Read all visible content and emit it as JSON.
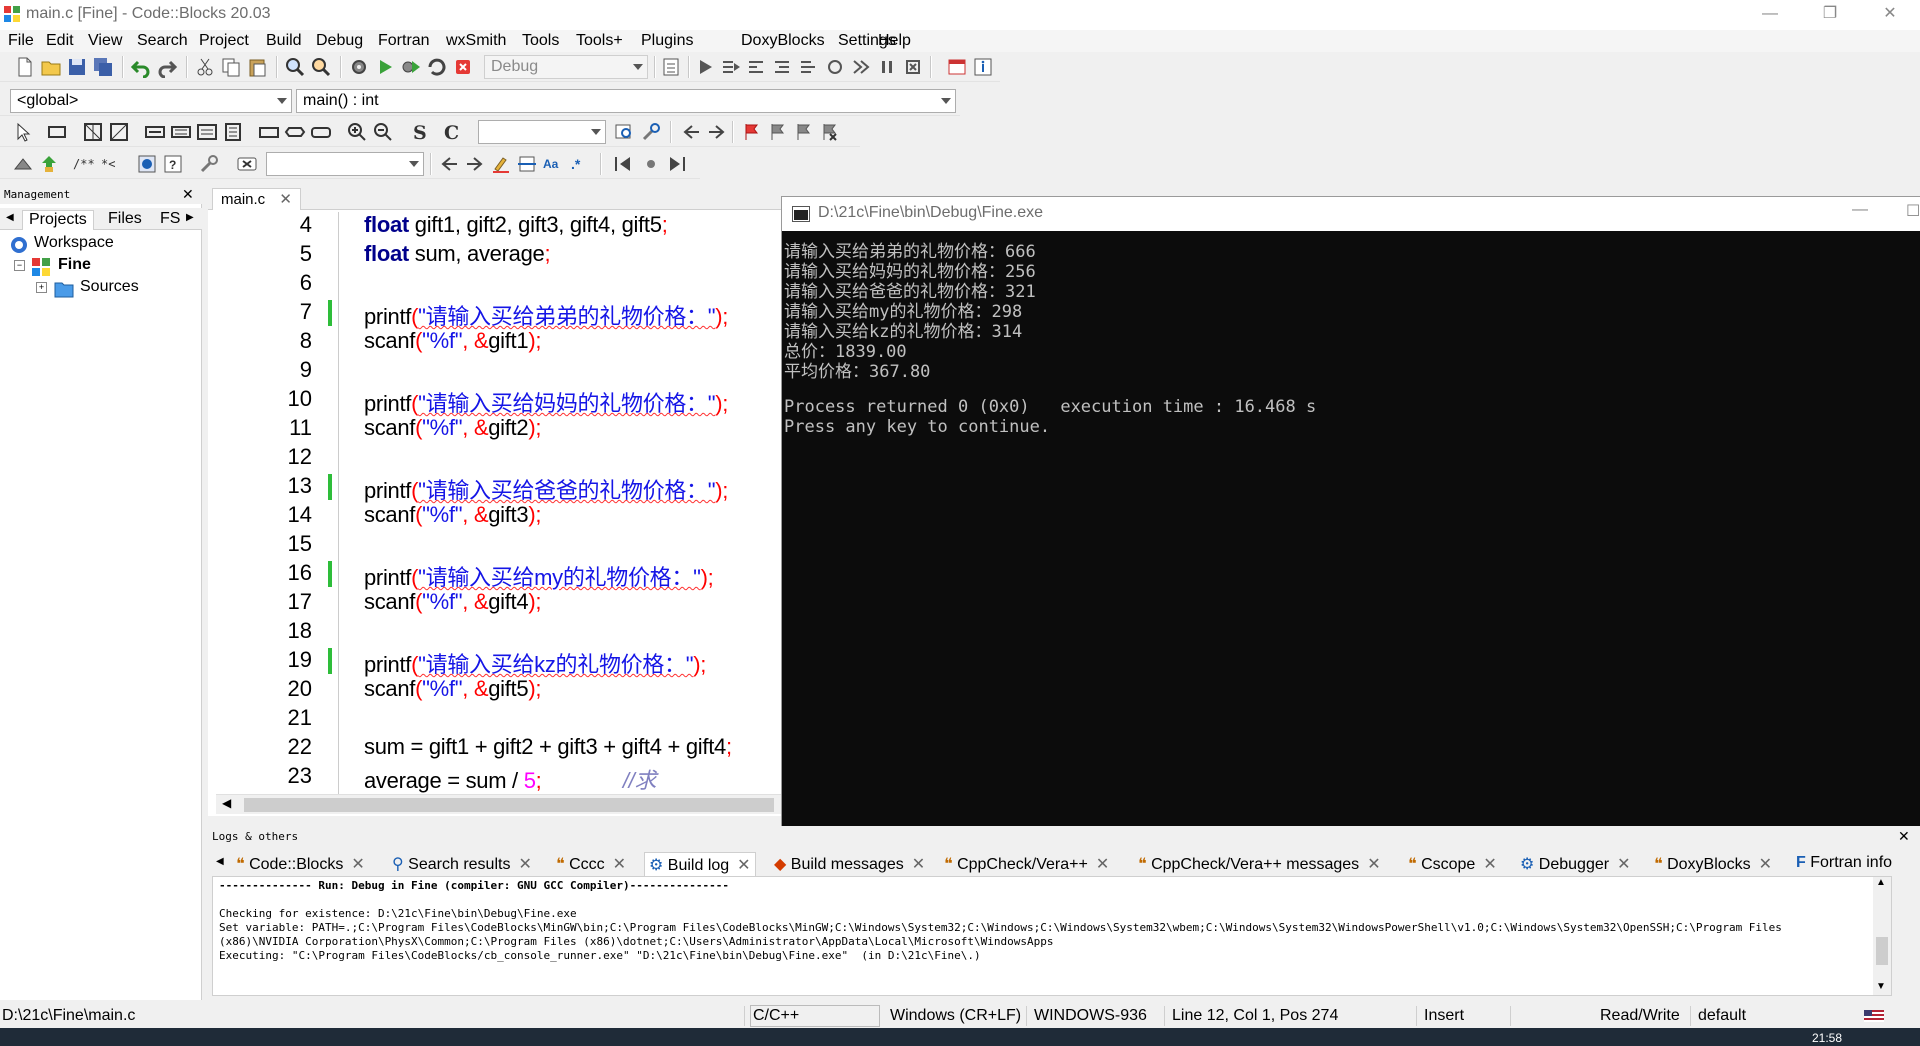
{
  "window": {
    "title": "main.c [Fine] - Code::Blocks 20.03"
  },
  "menu": [
    "File",
    "Edit",
    "View",
    "Search",
    "Project",
    "Build",
    "Debug",
    "Fortran",
    "wxSmith",
    "Tools",
    "Tools+",
    "Plugins",
    "DoxyBlocks",
    "Settings",
    "Help"
  ],
  "toolbar": {
    "build_target": "Debug",
    "scope": "<global>",
    "function": "main() : int"
  },
  "management": {
    "header": "Management",
    "tabs": [
      "Projects",
      "Files",
      "FS"
    ],
    "tree": {
      "workspace": "Workspace",
      "project": "Fine",
      "folder": "Sources"
    }
  },
  "editor": {
    "tab": "main.c",
    "lines": [
      {
        "n": "4",
        "changed": false
      },
      {
        "n": "5",
        "changed": false
      },
      {
        "n": "6",
        "changed": false
      },
      {
        "n": "7",
        "changed": true
      },
      {
        "n": "8",
        "changed": false
      },
      {
        "n": "9",
        "changed": false
      },
      {
        "n": "10",
        "changed": false
      },
      {
        "n": "11",
        "changed": false
      },
      {
        "n": "12",
        "changed": false
      },
      {
        "n": "13",
        "changed": true
      },
      {
        "n": "14",
        "changed": false
      },
      {
        "n": "15",
        "changed": false
      },
      {
        "n": "16",
        "changed": true
      },
      {
        "n": "17",
        "changed": false
      },
      {
        "n": "18",
        "changed": false
      },
      {
        "n": "19",
        "changed": true
      },
      {
        "n": "20",
        "changed": false
      },
      {
        "n": "21",
        "changed": false
      },
      {
        "n": "22",
        "changed": false
      },
      {
        "n": "23",
        "changed": false
      }
    ],
    "code": {
      "l4_kw": "float",
      "l4_rest": " gift1, gift2, gift3, gift4, gift5",
      "l5_kw": "float",
      "l5_rest": " sum, average",
      "printf": "printf",
      "scanf": "scanf",
      "fmt": "\"%f\"",
      "p1": "\"请输入买给弟弟的礼物价格：\"",
      "p2": "\"请输入买给妈妈的礼物价格：\"",
      "p3": "\"请输入买给爸爸的礼物价格：\"",
      "p4": "\"请输入买给my的礼物价格：\"",
      "p5": "\"请输入买给kz的礼物价格：\"",
      "s1": "gift1",
      "s2": "gift2",
      "s3": "gift3",
      "s4": "gift4",
      "s5": "gift5",
      "l22": "sum = gift1 + gift2 + gift3 + gift4 + gift4",
      "l23_a": "average = sum / ",
      "l23_num": "5",
      "l23_cmt": "//求"
    }
  },
  "console": {
    "title": "D:\\21c\\Fine\\bin\\Debug\\Fine.exe",
    "lines": [
      "请输入买给弟弟的礼物价格：666",
      "请输入买给妈妈的礼物价格：256",
      "请输入买给爸爸的礼物价格：321",
      "请输入买给my的礼物价格：298",
      "请输入买给kz的礼物价格：314",
      "总价：1839.00",
      "平均价格：367.80",
      "",
      "Process returned 0 (0x0)   execution time : 16.468 s",
      "Press any key to continue."
    ]
  },
  "logs": {
    "header": "Logs & others",
    "tabs": [
      "Code::Blocks",
      "Search results",
      "Cccc",
      "Build log",
      "Build messages",
      "CppCheck/Vera++",
      "CppCheck/Vera++ messages",
      "Cscope",
      "Debugger",
      "DoxyBlocks",
      "Fortran info"
    ],
    "active_tab": "Build log",
    "lines": [
      "-------------- Run: Debug in Fine (compiler: GNU GCC Compiler)---------------",
      "",
      "Checking for existence: D:\\21c\\Fine\\bin\\Debug\\Fine.exe",
      "Set variable: PATH=.;C:\\Program Files\\CodeBlocks\\MinGW\\bin;C:\\Program Files\\CodeBlocks\\MinGW;C:\\Windows\\System32;C:\\Windows;C:\\Windows\\System32\\wbem;C:\\Windows\\System32\\WindowsPowerShell\\v1.0;C:\\Windows\\System32\\OpenSSH;C:\\Program Files",
      "(x86)\\NVIDIA Corporation\\PhysX\\Common;C:\\Program Files (x86)\\dotnet;C:\\Users\\Administrator\\AppData\\Local\\Microsoft\\WindowsApps",
      "Executing: \"C:\\Program Files\\CodeBlocks/cb_console_runner.exe\" \"D:\\21c\\Fine\\bin\\Debug\\Fine.exe\"  (in D:\\21c\\Fine\\.)"
    ]
  },
  "status": {
    "path": "D:\\21c\\Fine\\main.c",
    "language": "C/C++",
    "eol": "Windows (CR+LF)",
    "encoding": "WINDOWS-936",
    "position": "Line 12, Col 1, Pos 274",
    "mode": "Insert",
    "access": "Read/Write",
    "profile": "default"
  },
  "taskbar": {
    "clock": "21:58"
  },
  "colors": {
    "accent": "#2ebd3a",
    "keyword": "#00008b",
    "string": "#1515e6",
    "operator": "#ff0000"
  }
}
